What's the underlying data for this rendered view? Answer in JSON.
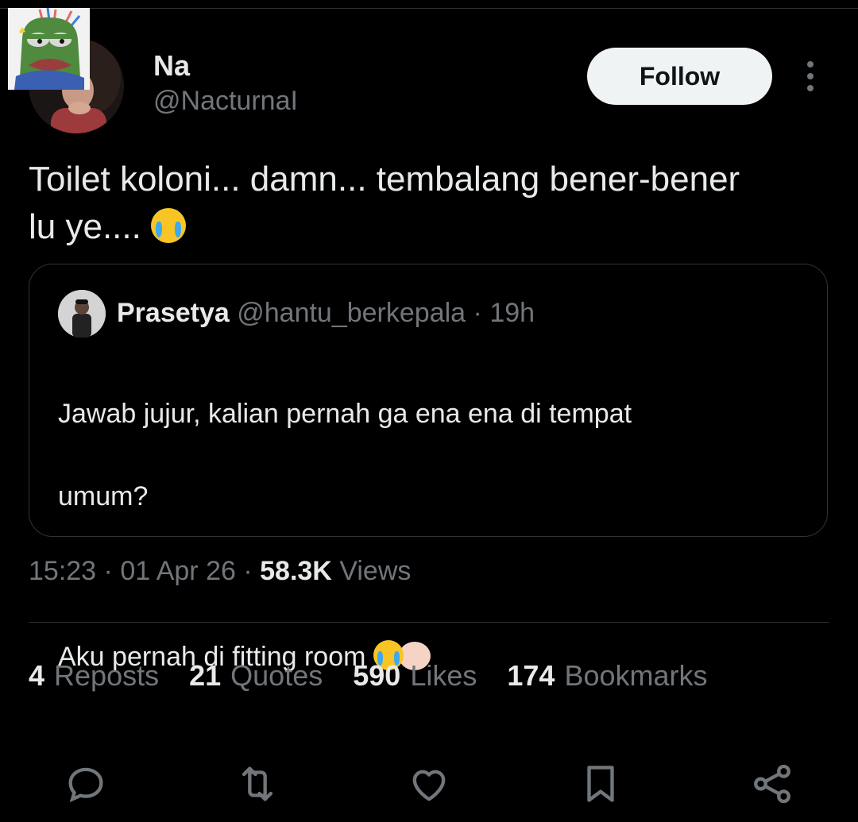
{
  "author": {
    "name": "Na",
    "handle": "@NacturnaI"
  },
  "follow_label": "Follow",
  "tweet": {
    "text_line1": "Toilet koloni... damn... tembalang bener-bener",
    "text_line2": "lu ye...."
  },
  "quoted": {
    "name": "Prasetya",
    "handle": "@hantu_berkepala",
    "separator": "·",
    "time": "19h",
    "text_line1": "Jawab jujur, kalian pernah ga ena ena di tempat",
    "text_line2": "umum?",
    "text_line3": "Aku pernah di fitting room"
  },
  "meta": {
    "time": "15:23",
    "sep1": "·",
    "date": "01 Apr 26",
    "sep2": "·",
    "views_count": "58.3K",
    "views_label": "Views"
  },
  "stats": [
    {
      "count": "4",
      "label": "Reposts"
    },
    {
      "count": "21",
      "label": "Quotes"
    },
    {
      "count": "590",
      "label": "Likes"
    },
    {
      "count": "174",
      "label": "Bookmarks"
    }
  ],
  "actions": {
    "icons": [
      "reply-icon",
      "repost-icon",
      "like-icon",
      "bookmark-icon",
      "share-icon"
    ]
  },
  "colors": {
    "background": "#000000",
    "text": "#e7e9ea",
    "muted": "#71767b",
    "border": "#2f3336",
    "follow_bg": "#eff3f4"
  }
}
